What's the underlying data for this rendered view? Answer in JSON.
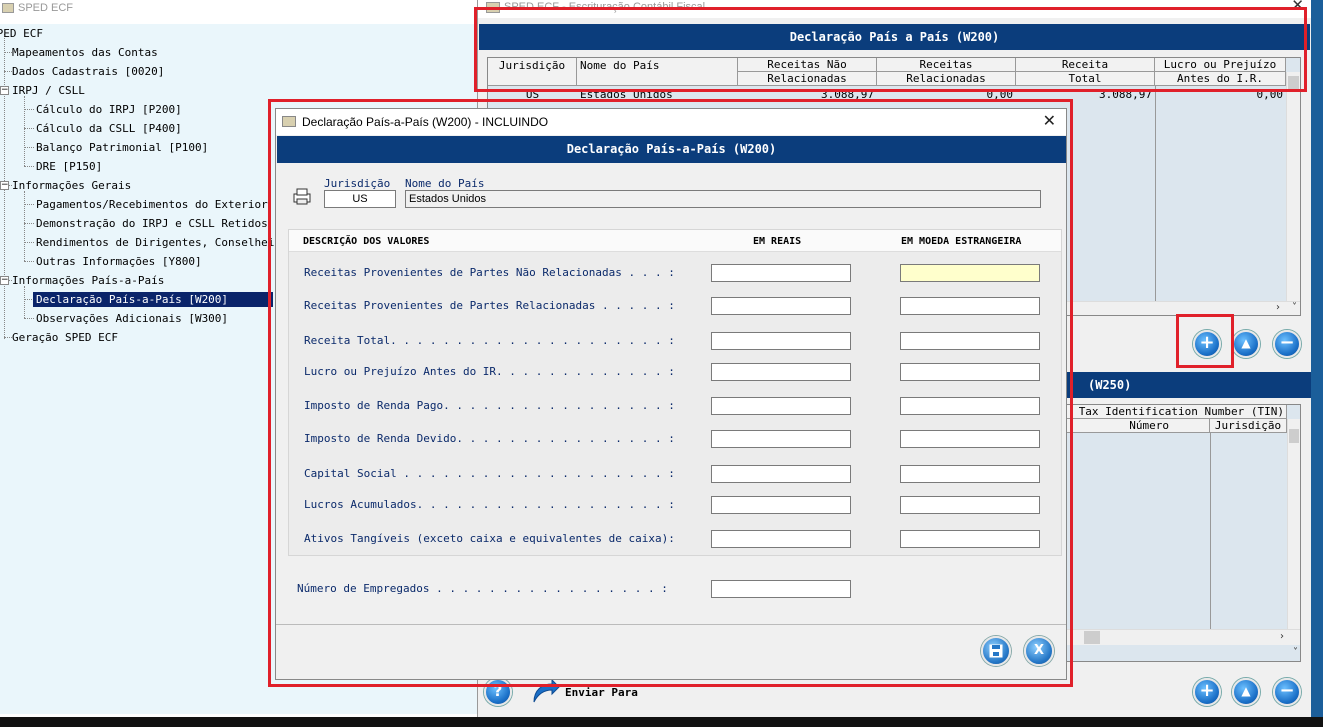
{
  "tree_window": {
    "title": "SPED ECF",
    "items": [
      {
        "label": "SPED ECF"
      },
      {
        "label": "Mapeamentos das Contas"
      },
      {
        "label": "Dados Cadastrais [0020]"
      },
      {
        "label": "IRPJ / CSLL"
      },
      {
        "label": "Cálculo do IRPJ [P200]"
      },
      {
        "label": "Cálculo da CSLL [P400]"
      },
      {
        "label": "Balanço Patrimonial [P100]"
      },
      {
        "label": "DRE [P150]"
      },
      {
        "label": "Informações Gerais"
      },
      {
        "label": "Pagamentos/Recebimentos do Exterior"
      },
      {
        "label": "Demonstração do IRPJ e CSLL Retidos"
      },
      {
        "label": "Rendimentos de Dirigentes, Conselheiros"
      },
      {
        "label": "Outras Informações [Y800]"
      },
      {
        "label": "Informações País-a-País"
      },
      {
        "label": "Declaração País-a-País [W200]"
      },
      {
        "label": "Observações Adicionais [W300]"
      },
      {
        "label": "Geração SPED ECF"
      }
    ]
  },
  "main_window": {
    "title": "SPED ECF  -  Escrituração Contábil Fiscal",
    "w200_header": "Declaração País a País  (W200)",
    "w200_columns": [
      {
        "top": "Jurisdição",
        "bottom": ""
      },
      {
        "top": "Nome do País",
        "bottom": ""
      },
      {
        "top": "Receitas Não",
        "bottom": "Relacionadas"
      },
      {
        "top": "Receitas",
        "bottom": "Relacionadas"
      },
      {
        "top": "Receita",
        "bottom": "Total"
      },
      {
        "top": "Lucro ou Prejuízo",
        "bottom": "Antes do I.R."
      }
    ],
    "w200_row": [
      "US",
      "Estados Unidos",
      "3.088,97",
      "0,00",
      "3.088,97",
      "0,00"
    ],
    "w250_header": "(W250)",
    "w250_col_group": "Tax Identification Number (TIN)",
    "w250_columns": [
      "Número",
      "Jurisdição"
    ],
    "buttons": {
      "add": "+",
      "up": "▲",
      "remove": "−",
      "help": "?"
    },
    "send_label": "Enviar Para"
  },
  "dialog": {
    "title": "Declaração País-a-País (W200)  -  INCLUINDO",
    "header": "Declaração País-a-País  (W200)",
    "jurisdicao_label": "Jurisdição",
    "nome_pais_label": "Nome do País",
    "jurisdicao_value": "US",
    "nome_pais_value": "Estados Unidos",
    "col_descricao": "DESCRIÇÃO DOS VALORES",
    "col_reais": "EM REAIS",
    "col_moeda": "EM MOEDA ESTRANGEIRA",
    "rows": [
      {
        "label": "Receitas Provenientes de Partes Não Relacionadas . . . :",
        "reais": "",
        "moeda": ""
      },
      {
        "label": "Receitas Provenientes de Partes Relacionadas . . . . . :",
        "reais": "",
        "moeda": ""
      },
      {
        "label": "Receita Total. . . . . . . . . . . . . . . . . . . . . :",
        "reais": "",
        "moeda": ""
      },
      {
        "label": "Lucro ou Prejuízo Antes do IR. . . . . . . . . . . . . :",
        "reais": "",
        "moeda": ""
      },
      {
        "label": "Imposto de Renda Pago. . . . . . . . . . . . . . . . . :",
        "reais": "",
        "moeda": ""
      },
      {
        "label": "Imposto de Renda Devido. . . . . . . . . . . . . . . . :",
        "reais": "",
        "moeda": ""
      },
      {
        "label": "Capital Social . . . . . . . . . . . . . . . . . . . . :",
        "reais": "",
        "moeda": ""
      },
      {
        "label": "Lucros Acumulados. . . . . . . . . . . . . . . . . . . :",
        "reais": "",
        "moeda": ""
      },
      {
        "label": "Ativos Tangíveis (exceto caixa e equivalentes de caixa):",
        "reais": "",
        "moeda": ""
      }
    ],
    "empregados_label": "Número de Empregados . . . . . . . . . . . . . . . . . :",
    "empregados_value": "",
    "save_icon_glyph": "💾",
    "cancel_icon_glyph": "X",
    "highlight_color": "#e0202a"
  }
}
